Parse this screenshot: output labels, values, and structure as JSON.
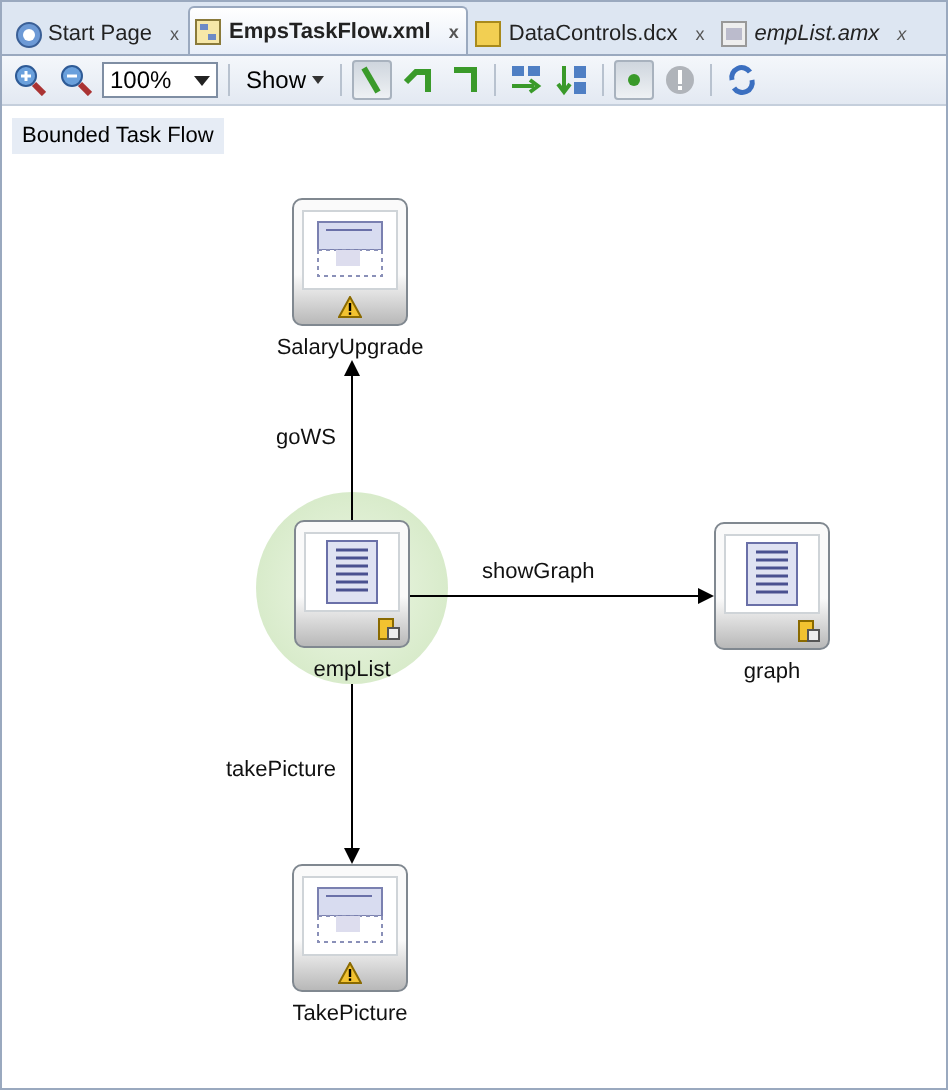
{
  "tabs": [
    {
      "label": "Start Page",
      "kind": "help",
      "selected": false,
      "preview": false,
      "close": "x"
    },
    {
      "label": "EmpsTaskFlow.xml",
      "kind": "taskflow",
      "selected": true,
      "preview": false,
      "close": "x"
    },
    {
      "label": "DataControls.dcx",
      "kind": "datacontrols",
      "selected": false,
      "preview": false,
      "close": "x"
    },
    {
      "label": "empList.amx",
      "kind": "page",
      "selected": false,
      "preview": true,
      "close": "x"
    }
  ],
  "toolbar": {
    "zoom": "100%",
    "show": "Show",
    "tools": [
      {
        "kind": "zoom-in",
        "pressed": false
      },
      {
        "kind": "zoom-out",
        "pressed": false
      },
      {
        "kind": "sep"
      },
      {
        "kind": "line-straight",
        "pressed": true
      },
      {
        "kind": "line-elbow",
        "pressed": false
      },
      {
        "kind": "line-corner",
        "pressed": false
      },
      {
        "kind": "sep"
      },
      {
        "kind": "layout-horizontal",
        "pressed": false
      },
      {
        "kind": "layout-vertical",
        "pressed": false
      },
      {
        "kind": "sep"
      },
      {
        "kind": "dot",
        "pressed": true
      },
      {
        "kind": "warning-circle",
        "pressed": false
      },
      {
        "kind": "sep"
      },
      {
        "kind": "refresh",
        "pressed": false
      }
    ]
  },
  "flow_label": "Bounded Task Flow",
  "nodes": [
    {
      "name": "SalaryUpgrade",
      "kind": "task-flow-call",
      "warning": true,
      "default": false
    },
    {
      "name": "empList",
      "kind": "view",
      "warning": false,
      "default": true
    },
    {
      "name": "graph",
      "kind": "view",
      "warning": false,
      "default": false
    },
    {
      "name": "TakePicture",
      "kind": "task-flow-call",
      "warning": true,
      "default": false
    }
  ],
  "edges": [
    {
      "label": "goWS"
    },
    {
      "label": "showGraph"
    },
    {
      "label": "takePicture"
    }
  ]
}
